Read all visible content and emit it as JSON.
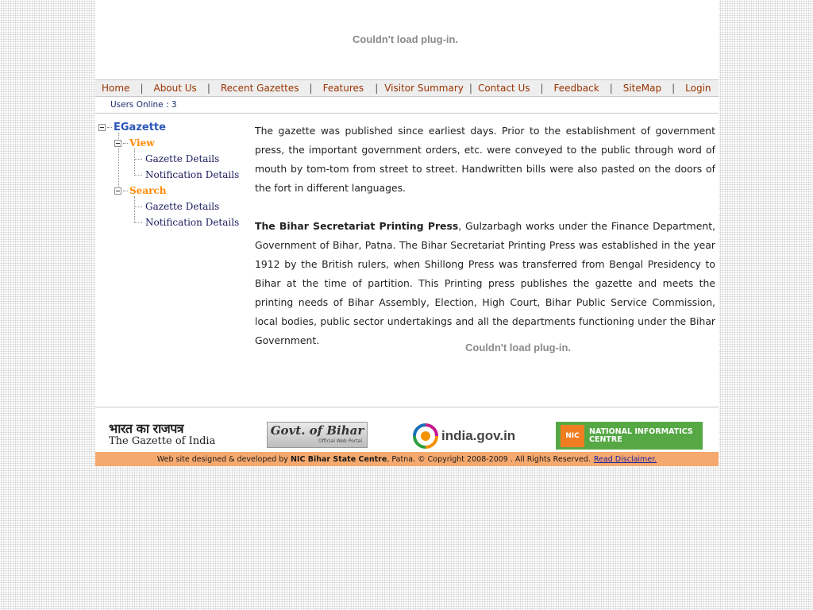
{
  "top_plugin": {
    "message": "Couldn't load plug-in."
  },
  "nav": {
    "items": [
      "Home",
      "About Us",
      "Recent Gazettes",
      "Features",
      "Visitor Summary",
      "Contact Us",
      "Feedback",
      "SiteMap",
      "Login"
    ],
    "separator": "|"
  },
  "users_online": "Users Online : 3",
  "tree": {
    "root": "EGazette",
    "view": {
      "label": "View",
      "children": [
        "Gazette Details",
        "Notification Details"
      ]
    },
    "search": {
      "label": "Search",
      "children": [
        "Gazette Details",
        "Notification Details"
      ]
    }
  },
  "content": {
    "para1": "The gazette was published since earliest days. Prior to the establishment of government press, the important government orders, etc. were conveyed to the public through word of mouth by tom-tom from street to street. Handwritten bills were also pasted on the doors of the fort in different languages.",
    "para2_bold": "The Bihar Secretariat Printing Press",
    "para2_rest": ", Gulzarbagh works under the Finance Department, Government of Bihar, Patna. The Bihar Secretariat Printing Press was established in the year 1912 by the British rulers, when Shillong Press was transferred from Bengal Presidency to Bihar at the time of partition. This Printing press publishes the gazette and meets the printing needs of Bihar Assembly, Election, High Court, Bihar Public Service Commission, local bodies, public sector undertakings and all the departments functioning under the Bihar Government."
  },
  "content_plugin": {
    "message": "Couldn't load plug-in."
  },
  "logos": {
    "gazette": {
      "hindi": "भारत का राजपत्र",
      "english": "The Gazette of India"
    },
    "bihar": {
      "title": "Govt. of Bihar",
      "subtitle": "Official Web Portal"
    },
    "india": {
      "text": "india.gov.in"
    },
    "nic": {
      "badge": "NIC",
      "line1": "NATIONAL INFORMATICS",
      "line2": "CENTRE"
    }
  },
  "footer": {
    "prefix": "Web site designed & developed by",
    "org": "NIC Bihar State Centre",
    "suffix": ", Patna.  © Copyright 2008-2009 . All Rights Reserved.",
    "link": "Read Disclaimer."
  },
  "colors": {
    "nav_link": "#993300",
    "tree_root": "#2b56b8",
    "tree_sub": "#ff8800",
    "footer_bg": "#f6a96e"
  }
}
